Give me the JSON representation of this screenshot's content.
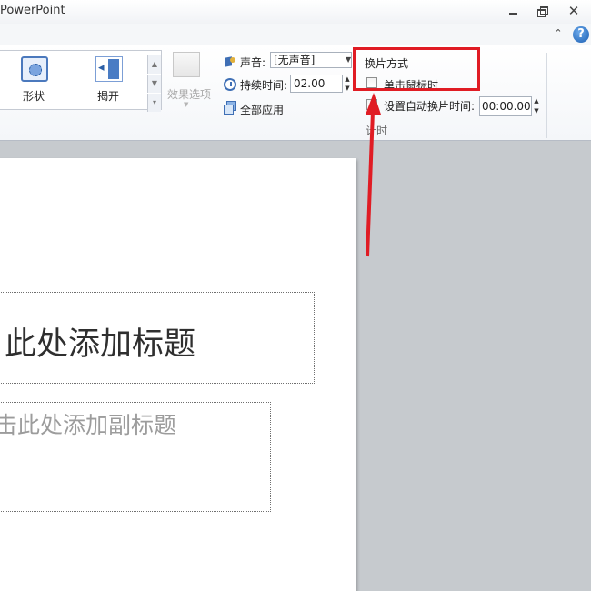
{
  "titlebar": {
    "app_title": "PowerPoint",
    "close_glyph": "✕"
  },
  "helpbar": {
    "collapse_glyph": "⌃",
    "help_glyph": "?"
  },
  "gallery": {
    "items": [
      {
        "label": "形状",
        "icon": "shape-icon"
      },
      {
        "label": "揭开",
        "icon": "uncover-icon"
      }
    ],
    "scroll_up": "▲",
    "scroll_down": "▼",
    "more": "▾"
  },
  "effect_options": {
    "label": "效果选项",
    "arrow": "▼"
  },
  "timing": {
    "sound_label": "声音:",
    "sound_value": "[无声音]",
    "sound_caret": "▼",
    "duration_label": "持续时间:",
    "duration_value": "02.00",
    "spin_up": "▲",
    "spin_down": "▼",
    "apply_all_label": "全部应用",
    "advance_header": "换片方式",
    "on_click_label": "单击鼠标时",
    "after_label": "设置自动换片时间:",
    "after_value": "00:00.00",
    "group_label": "计时"
  },
  "slide": {
    "title_text": "此处添加标题",
    "subtitle_text": "击此处添加副标题"
  },
  "colors": {
    "highlight": "#e01c24",
    "accent": "#3f6fb5"
  }
}
